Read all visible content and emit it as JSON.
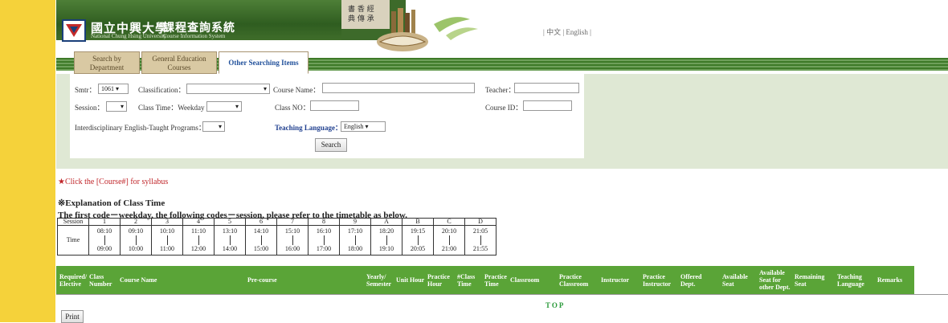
{
  "header": {
    "university_name": "國立中興大學",
    "university_sub": "National Chung Hsing University",
    "system_name": "課程查詢系統",
    "system_sub": "Course Information System",
    "lang_sep_left": "|",
    "lang_zh": "中文",
    "lang_sep": "|",
    "lang_en": "English",
    "lang_sep_right": "|"
  },
  "tabs": [
    {
      "label": "Search by Department"
    },
    {
      "label": "General Education Courses"
    },
    {
      "label": "Other Searching Items"
    }
  ],
  "form": {
    "semester_label": "Smtr：",
    "semester_value": "1061 ▾",
    "classification_label": "Classification：",
    "classification_value": "▾",
    "course_name_label": "Course Name：",
    "teacher_label": "Teacher：",
    "session_label": "Session：",
    "session_value": "▾",
    "class_time_label": "Class Time：Weekday",
    "class_time_value": "▾",
    "class_no_label": "Class NO：",
    "course_id_label": "Course ID：",
    "interdisciplinary_label": "Interdisciplinary English-Taught Programs：",
    "interdisciplinary_value": "▾",
    "teaching_language_label": "Teaching Language：",
    "teaching_language_value": "English ▾",
    "search_button": "Search"
  },
  "syllabus_link": "★Click the [Course#] for syllabus",
  "explanation": {
    "title": "※Explanation of Class Time",
    "line": "The first code－weekday, the following codes－session, please refer to the timetable as below."
  },
  "timetable": {
    "session_label": "Session",
    "time_label": "Time",
    "sessions": [
      "1",
      "2",
      "3",
      "4",
      "5",
      "6",
      "7",
      "8",
      "9",
      "A",
      "B",
      "C",
      "D"
    ],
    "starts": [
      "08:10",
      "09:10",
      "10:10",
      "11:10",
      "13:10",
      "14:10",
      "15:10",
      "16:10",
      "17:10",
      "18:20",
      "19:15",
      "20:10",
      "21:05"
    ],
    "ends": [
      "09:00",
      "10:00",
      "11:00",
      "12:00",
      "14:00",
      "15:00",
      "16:00",
      "17:00",
      "18:00",
      "19:10",
      "20:05",
      "21:00",
      "21:55"
    ]
  },
  "results_header": {
    "required": "Required/ Elective",
    "class_number": "Class Number",
    "course_name": "Course Name",
    "pre_course": "Pre-course",
    "yearly": "Yearly/ Semester",
    "unit": "Unit",
    "hour": "Hour",
    "practice_hour": "Practice Hour",
    "class_time": "#Class Time",
    "practice_time": "Practice Time",
    "classroom": "Classroom",
    "practice_classroom": "Practice Classroom",
    "instructor": "Instructor",
    "practice_instructor": "Practice Instructor",
    "offered_dept": "Offered Dept.",
    "available_seat": "Available Seat",
    "available_other": "Available Seat for other Dept.",
    "remaining_seat": "Remaining Seat",
    "teaching_language": "Teaching Language",
    "remarks": "Remarks"
  },
  "top_link": "TOP",
  "print_button": "Print",
  "colors": {
    "yellow_bar": "#f5d23a",
    "banner_green": "#3f6d2a",
    "panel_bg": "#dfe8d4",
    "results_header": "#5aa437",
    "link_red": "#c0262a"
  }
}
